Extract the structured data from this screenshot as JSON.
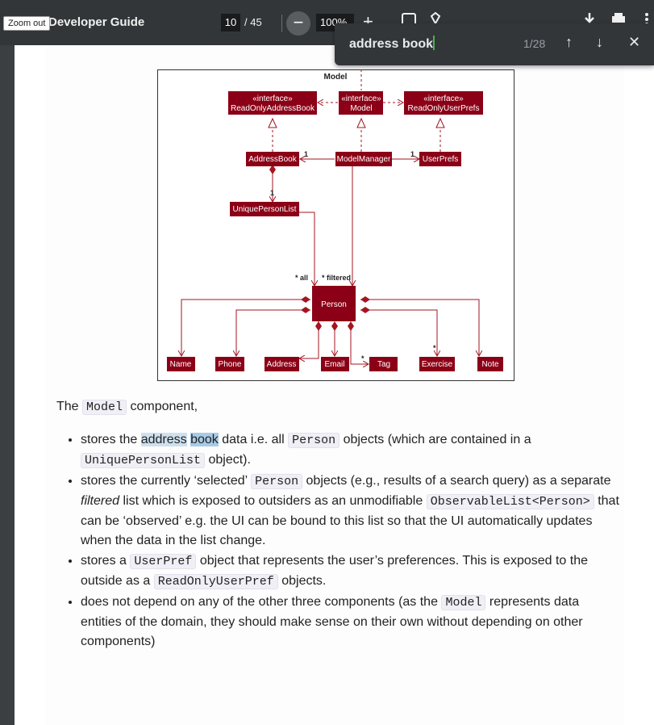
{
  "toolbar": {
    "tooltip": "Zoom out",
    "title": "Developer Guide",
    "page_current": "10",
    "page_total": "/ 45",
    "zoom_out_label": "−",
    "zoom_value": "100%",
    "zoom_in_label": "+",
    "icons": [
      "fit-page-icon",
      "rotate-icon",
      "download-icon",
      "print-icon",
      "more-icon"
    ]
  },
  "find_bar": {
    "query": "address book",
    "count": "1/28",
    "prev_label": "↑",
    "next_label": "↓",
    "close_label": "✕"
  },
  "diagram": {
    "package_title": "Model",
    "nodes": {
      "ro_ab_stereo": "«interface»",
      "ro_ab_name": "ReadOnlyAddressBook",
      "model_stereo": "«interface»",
      "model_name": "Model",
      "ro_up_stereo": "«interface»",
      "ro_up_name": "ReadOnlyUserPrefs",
      "address_book": "AddressBook",
      "model_manager": "ModelManager",
      "user_prefs": "UserPrefs",
      "unique_person_list": "UniquePersonList",
      "person": "Person",
      "name": "Name",
      "phone": "Phone",
      "address": "Address",
      "email": "Email",
      "tag": "Tag",
      "exercise": "Exercise",
      "note": "Note"
    },
    "multiplicities": {
      "ab_one": "1",
      "up_one": "1",
      "upl_one": "1",
      "all": "* all",
      "filtered": "* filtered",
      "tag_star": "*",
      "exercise_star": "*"
    },
    "colors": {
      "node_fill": "#8b0016",
      "line": "#a31621",
      "text": "#ffffff"
    }
  },
  "content": {
    "intro_prefix": "The",
    "intro_code": "Model",
    "intro_suffix": "component,",
    "b1_pre": "stores the",
    "b1_hl1": "address",
    "b1_hl2": "book",
    "b1_mid": "data i.e. all",
    "b1_code1": "Person",
    "b1_mid2": "objects (which are contained in a",
    "b1_code2": "UniquePersonList",
    "b1_end": "object).",
    "b2_pre": "stores the currently ‘selected’",
    "b2_code1": "Person",
    "b2_mid": "objects (e.g., results of a search query) as a separate",
    "b2_em": "filtered",
    "b2_mid2": "list which is exposed to outsiders as an unmodifiable",
    "b2_code2": "ObservableList<Person>",
    "b2_end": "that can be ‘observed’ e.g. the UI can be bound to this list so that the UI automatically updates when the data in the list change.",
    "b3_pre": "stores a",
    "b3_code1": "UserPref",
    "b3_mid": "object that represents the user’s preferences. This is exposed to the outside as a",
    "b3_code2": "ReadOnlyUserPref",
    "b3_end": "objects.",
    "b4_pre": "does not depend on any of the other three components (as the",
    "b4_code": "Model",
    "b4_end": "represents data entities of the domain, they should make sense on their own without depending on other components)"
  }
}
